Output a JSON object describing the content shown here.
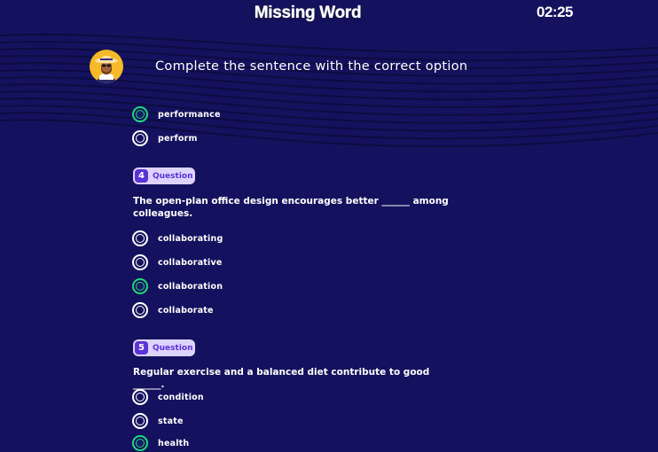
{
  "header": {
    "title": "Missing Word",
    "timer": "02:25",
    "prompt": "Complete the sentence with the correct option"
  },
  "colors": {
    "background": "#14125e",
    "selected": "#1ed87a",
    "badge_bg": "#ddd3ff",
    "badge_accent": "#5a33d6"
  },
  "previous_question": {
    "options": [
      {
        "label": "performance",
        "selected": true
      },
      {
        "label": "perform",
        "selected": false
      }
    ]
  },
  "questions": [
    {
      "badge_number": "4",
      "badge_label": "Question",
      "text": "The open-plan office design encourages better ______ among colleagues.",
      "options": [
        {
          "label": "collaborating",
          "selected": false
        },
        {
          "label": "collaborative",
          "selected": false
        },
        {
          "label": "collaboration",
          "selected": true
        },
        {
          "label": "collaborate",
          "selected": false
        }
      ]
    },
    {
      "badge_number": "5",
      "badge_label": "Question",
      "text": "Regular exercise and a balanced diet contribute to good ______.",
      "options": [
        {
          "label": "condition",
          "selected": false
        },
        {
          "label": "state",
          "selected": false
        },
        {
          "label": "health",
          "selected": true
        }
      ]
    }
  ]
}
